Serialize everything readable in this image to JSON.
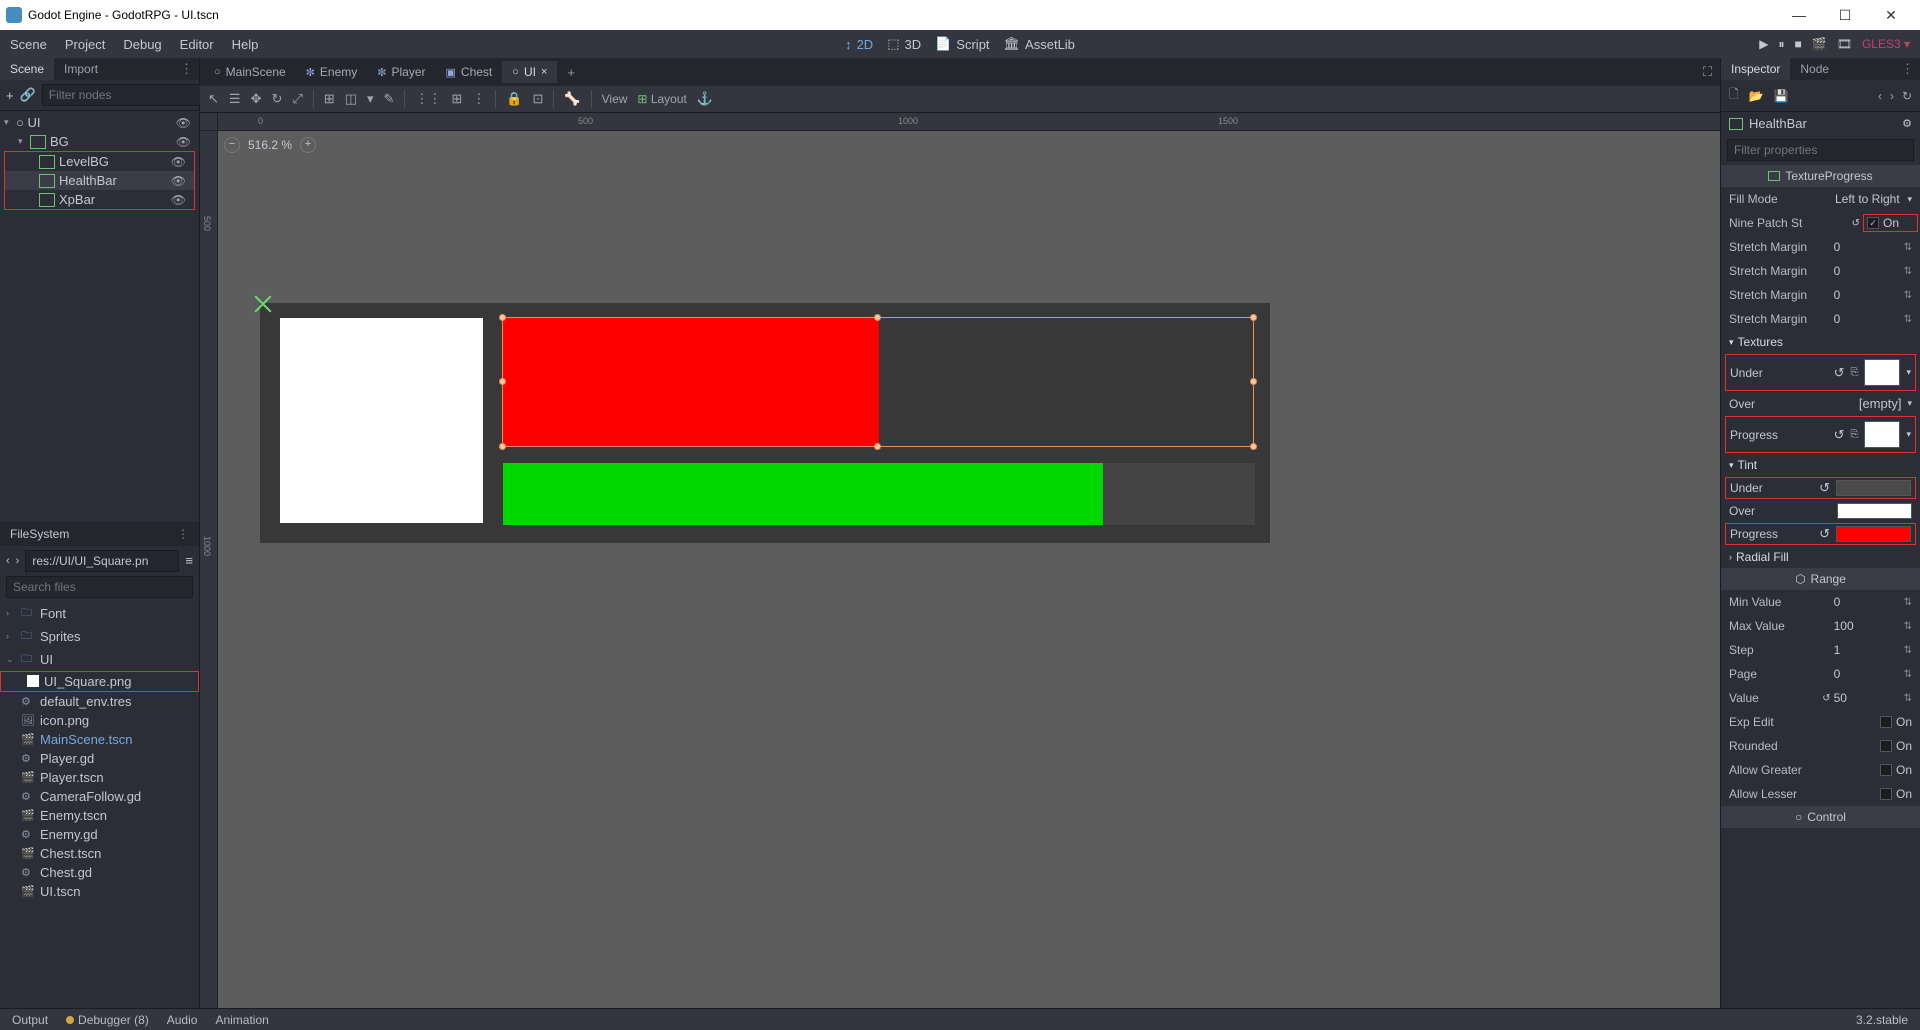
{
  "window": {
    "title": "Godot Engine - GodotRPG - UI.tscn"
  },
  "menubar": {
    "items": [
      "Scene",
      "Project",
      "Debug",
      "Editor",
      "Help"
    ],
    "center": {
      "twod": "2D",
      "threed": "3D",
      "script": "Script",
      "assetlib": "AssetLib"
    },
    "renderer": "GLES3"
  },
  "scene_panel": {
    "tab_scene": "Scene",
    "tab_import": "Import",
    "filter_placeholder": "Filter nodes",
    "nodes": {
      "root": "UI",
      "bg": "BG",
      "levelbg": "LevelBG",
      "healthbar": "HealthBar",
      "xpbar": "XpBar"
    }
  },
  "editor_tabs": {
    "main": "MainScene",
    "enemy": "Enemy",
    "player": "Player",
    "chest": "Chest",
    "ui": "UI"
  },
  "view_toolbar": {
    "view": "View",
    "layout": "Layout"
  },
  "zoom": "516.2 %",
  "ruler_h": {
    "a": "0",
    "b": "500",
    "c": "1000",
    "d": "1500"
  },
  "ruler_v": {
    "a": "500",
    "b": "1000"
  },
  "filesystem": {
    "title": "FileSystem",
    "path": "res://UI/UI_Square.pn",
    "search_placeholder": "Search files",
    "items": {
      "font": "Font",
      "sprites": "Sprites",
      "ui": "UI",
      "ui_square": "UI_Square.png",
      "default_env": "default_env.tres",
      "icon": "icon.png",
      "mainscene": "MainScene.tscn",
      "player_gd": "Player.gd",
      "player_tscn": "Player.tscn",
      "camera": "CameraFollow.gd",
      "enemy_tscn": "Enemy.tscn",
      "enemy_gd": "Enemy.gd",
      "chest_tscn": "Chest.tscn",
      "chest_gd": "Chest.gd",
      "ui_tscn": "UI.tscn"
    }
  },
  "inspector": {
    "tab_inspector": "Inspector",
    "tab_node": "Node",
    "node_name": "HealthBar",
    "filter_placeholder": "Filter properties",
    "class_name": "TextureProgress",
    "fill_mode": {
      "label": "Fill Mode",
      "value": "Left to Right"
    },
    "nine_patch": {
      "label": "Nine Patch St",
      "value": "On"
    },
    "stretch_margin": {
      "label": "Stretch Margin",
      "value": "0"
    },
    "sections": {
      "textures": "Textures",
      "tint": "Tint",
      "radial": "Radial Fill",
      "range": "Range",
      "control": "Control"
    },
    "tex": {
      "under": "Under",
      "over": "Over",
      "over_val": "[empty]",
      "progress": "Progress"
    },
    "tint": {
      "under": "Under",
      "under_color": "#4a4a4a",
      "over": "Over",
      "over_color": "#ffffff",
      "progress": "Progress",
      "progress_color": "#ff0000"
    },
    "range": {
      "min": {
        "label": "Min Value",
        "value": "0"
      },
      "max": {
        "label": "Max Value",
        "value": "100"
      },
      "step": {
        "label": "Step",
        "value": "1"
      },
      "page": {
        "label": "Page",
        "value": "0"
      },
      "value": {
        "label": "Value",
        "value": "50"
      },
      "exp": {
        "label": "Exp Edit",
        "value": "On"
      },
      "rounded": {
        "label": "Rounded",
        "value": "On"
      },
      "greater": {
        "label": "Allow Greater",
        "value": "On"
      },
      "lesser": {
        "label": "Allow Lesser",
        "value": "On"
      }
    }
  },
  "bottom": {
    "output": "Output",
    "debugger": "Debugger (8)",
    "audio": "Audio",
    "animation": "Animation",
    "version": "3.2.stable"
  }
}
